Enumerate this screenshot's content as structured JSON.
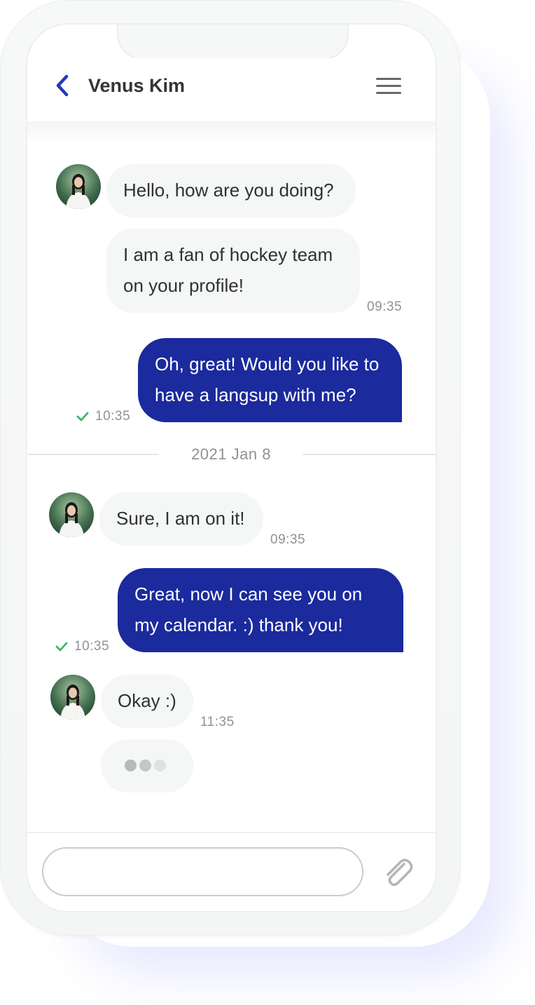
{
  "header": {
    "contact_name": "Venus Kim",
    "back_icon": "chevron-left-icon",
    "menu_icon": "hamburger-menu-icon"
  },
  "messages": [
    {
      "direction": "incoming",
      "text": "Hello, how are you doing?"
    },
    {
      "direction": "incoming",
      "text": "I am a fan of hockey team on your profile!",
      "time": "09:35"
    },
    {
      "direction": "outgoing",
      "text": "Oh, great! Would you like to have a langsup with me?",
      "time": "10:35",
      "status": "delivered"
    },
    {
      "direction": "incoming",
      "text": "Sure, I am on it!",
      "time": "09:35"
    },
    {
      "direction": "outgoing",
      "text": "Great, now I can see you on my calendar. :) thank you!",
      "time": "10:35",
      "status": "delivered"
    },
    {
      "direction": "incoming",
      "text": "Okay :)",
      "time": "11:35"
    }
  ],
  "date_divider": "2021 Jan 8",
  "typing_indicator": {
    "visible": true,
    "dots": 3
  },
  "composer": {
    "input_value": "",
    "placeholder": "",
    "attach_icon": "paperclip-icon"
  },
  "colors": {
    "accent": "#1b2a9c",
    "incoming_bubble": "#f5f6f6",
    "check": "#3cb46e",
    "back_arrow": "#2536b8"
  }
}
